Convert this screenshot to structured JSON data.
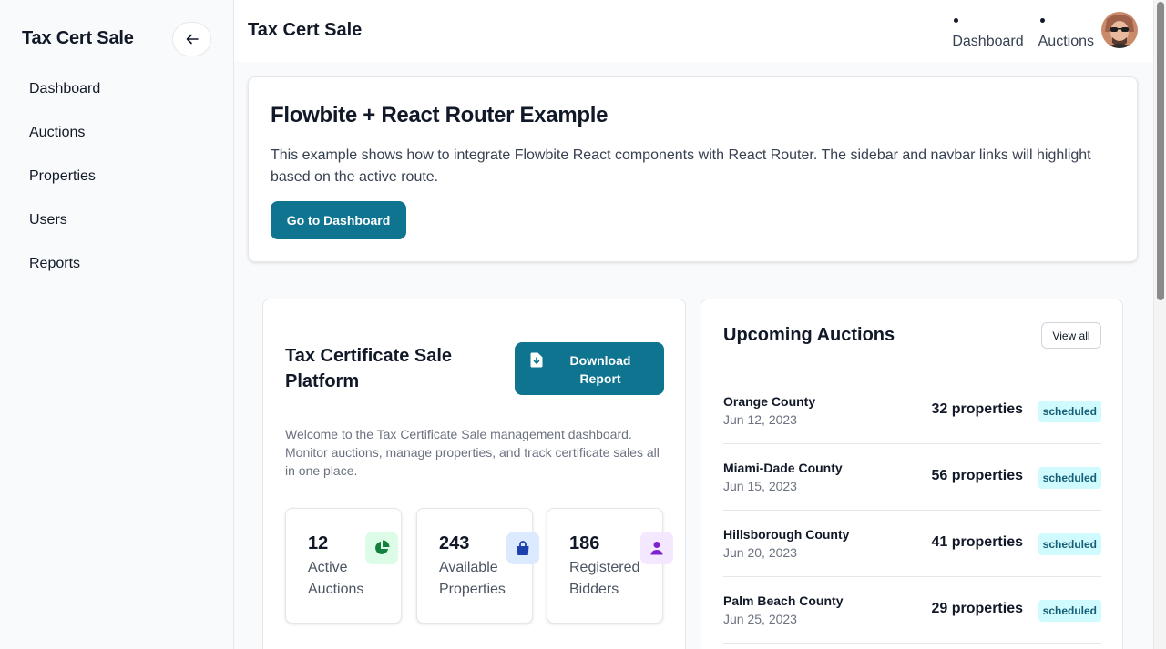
{
  "sidebar": {
    "brand": "Tax Cert Sale",
    "items": [
      {
        "label": "Dashboard"
      },
      {
        "label": "Auctions"
      },
      {
        "label": "Properties"
      },
      {
        "label": "Users"
      },
      {
        "label": "Reports"
      }
    ]
  },
  "header": {
    "title": "Tax Cert Sale",
    "nav": [
      {
        "label": "Dashboard"
      },
      {
        "label": "Auctions"
      }
    ]
  },
  "hero": {
    "title": "Flowbite + React Router Example",
    "description": "This example shows how to integrate Flowbite React components with React Router. The sidebar and navbar links will highlight based on the active route.",
    "button_label": "Go to Dashboard"
  },
  "platform": {
    "title": "Tax Certificate Sale Platform",
    "download_label": "Download Report",
    "description": "Welcome to the Tax Certificate Sale management dashboard. Monitor auctions, manage properties, and track certificate sales all in one place.",
    "stats": [
      {
        "value": "12",
        "label": "Active Auctions",
        "icon": "chart-pie-icon",
        "icon_color": "#15803d",
        "icon_bg": "#dcfce7"
      },
      {
        "value": "243",
        "label": "Available Properties",
        "icon": "shopping-bag-icon",
        "icon_color": "#1e40af",
        "icon_bg": "#dbeafe"
      },
      {
        "value": "186",
        "label": "Registered Bidders",
        "icon": "user-icon",
        "icon_color": "#7e22ce",
        "icon_bg": "#f3e8ff"
      }
    ]
  },
  "auctions": {
    "title": "Upcoming Auctions",
    "view_all_label": "View all",
    "rows": [
      {
        "county": "Orange County",
        "date": "Jun 12, 2023",
        "properties": "32 properties",
        "status": "scheduled"
      },
      {
        "county": "Miami-Dade County",
        "date": "Jun 15, 2023",
        "properties": "56 properties",
        "status": "scheduled"
      },
      {
        "county": "Hillsborough County",
        "date": "Jun 20, 2023",
        "properties": "41 properties",
        "status": "scheduled"
      },
      {
        "county": "Palm Beach County",
        "date": "Jun 25, 2023",
        "properties": "29 properties",
        "status": "scheduled"
      }
    ]
  },
  "colors": {
    "primary": "#0e7490",
    "badge_bg": "#cffafe",
    "badge_text": "#155e75"
  }
}
